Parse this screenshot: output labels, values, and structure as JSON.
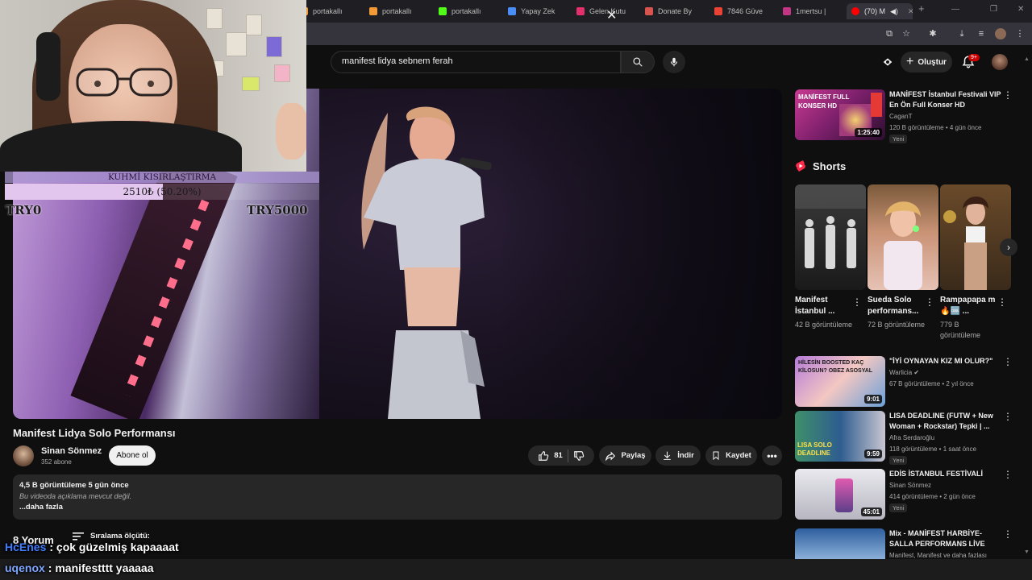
{
  "browser": {
    "tabs": [
      {
        "label": "portakallı",
        "color": "#f29a37"
      },
      {
        "label": "portakallı",
        "color": "#f29a37"
      },
      {
        "label": "portakallı",
        "color": "#53fc18"
      },
      {
        "label": "Yapay Zek",
        "color": "#4a8df6"
      },
      {
        "label": "Gelen Kutu",
        "color": "#e1306c"
      },
      {
        "label": "Donate By",
        "color": "#d9534f"
      },
      {
        "label": "7846 Güve",
        "color": "#ea4335"
      },
      {
        "label": "1mertsu |",
        "color": "#c13584"
      },
      {
        "label": "(70) M",
        "color": "#ff0000"
      }
    ]
  },
  "youtube": {
    "search": {
      "value": "manifest lidya sebnem ferah"
    },
    "create_label": "Oluştur",
    "notifications_badge": "9+"
  },
  "video": {
    "title": "Manifest Lidya Solo Performansı",
    "channel": "Sinan Sönmez",
    "subscribers": "352 abone",
    "subscribe_label": "Abone ol",
    "likes": "81",
    "share_label": "Paylaş",
    "download_label": "İndir",
    "save_label": "Kaydet",
    "stats": "4,5 B görüntüleme  5 gün önce",
    "description": "Bu videoda açıklama mevcut değil.",
    "more_label": "...daha fazla",
    "comments_count": "8 Yorum",
    "sort_label": "Sıralama ölçütü:"
  },
  "sidebar": {
    "top_video": {
      "title": "MANİFEST İstanbul Festivali VIP En Ön Full Konser HD",
      "channel": "CaganT",
      "meta": "120 B görüntüleme • 4 gün önce",
      "badge": "Yeni",
      "duration": "1:25:40",
      "thumb_text": "MANİFEST FULL KONSER HD"
    },
    "shorts_heading": "Shorts",
    "shorts": [
      {
        "title": "Manifest İstanbul ...",
        "views": "42 B görüntüleme"
      },
      {
        "title": "Sueda Solo performans...",
        "views": "72 B görüntüleme"
      },
      {
        "title": "Rampapapa m🔥🆒 ...",
        "views": "779 B görüntüleme"
      }
    ],
    "videos": [
      {
        "title": "\"İYİ OYNAYAN KIZ MI OLUR?\"",
        "channel": "Warlicia",
        "verified": true,
        "meta": "67 B görüntüleme • 2 yıl önce",
        "badge": "",
        "duration": "9:01",
        "thumb_text": "HİLESİN BOOSTED KAÇ KİLOSUN? OBEZ ASOSYAL"
      },
      {
        "title": "LISA DEADLINE (FUTW + New Woman + Rockstar) Tepki | ...",
        "channel": "Afra Serdaroğlu",
        "verified": false,
        "meta": "118 görüntüleme • 1 saat önce",
        "badge": "Yeni",
        "duration": "9:59",
        "thumb_text": "LISA SOLO DEADLINE"
      },
      {
        "title": "EDİS İSTANBUL FESTİVALİ",
        "channel": "Sinan Sönmez",
        "verified": false,
        "meta": "414 görüntüleme • 2 gün önce",
        "badge": "Yeni",
        "duration": "45:01",
        "thumb_text": ""
      },
      {
        "title": "Mix - MANİFEST HARBİYE-SALLA PERFORMANS LİVE",
        "channel": "Manifest, Manifest ve daha fazlası",
        "verified": false,
        "meta": "",
        "badge": "",
        "duration": "",
        "thumb_text": ""
      }
    ]
  },
  "stream_overlay": {
    "goal_title": "KUHMİ KISIRLAŞTIRMA",
    "goal_amount": "2510₺ (50.20%)",
    "goal_fraction": 0.502,
    "goal_min": "TRY0",
    "goal_max": "TRY5000",
    "chat": [
      {
        "user": "HcEnes",
        "user_color": "#3f7cff",
        "message": ": çok güzelmiş kapaaaat"
      },
      {
        "user": "uqenox",
        "user_color": "#7fa7ff",
        "message": ": manifestttt yaaaaa"
      }
    ]
  }
}
